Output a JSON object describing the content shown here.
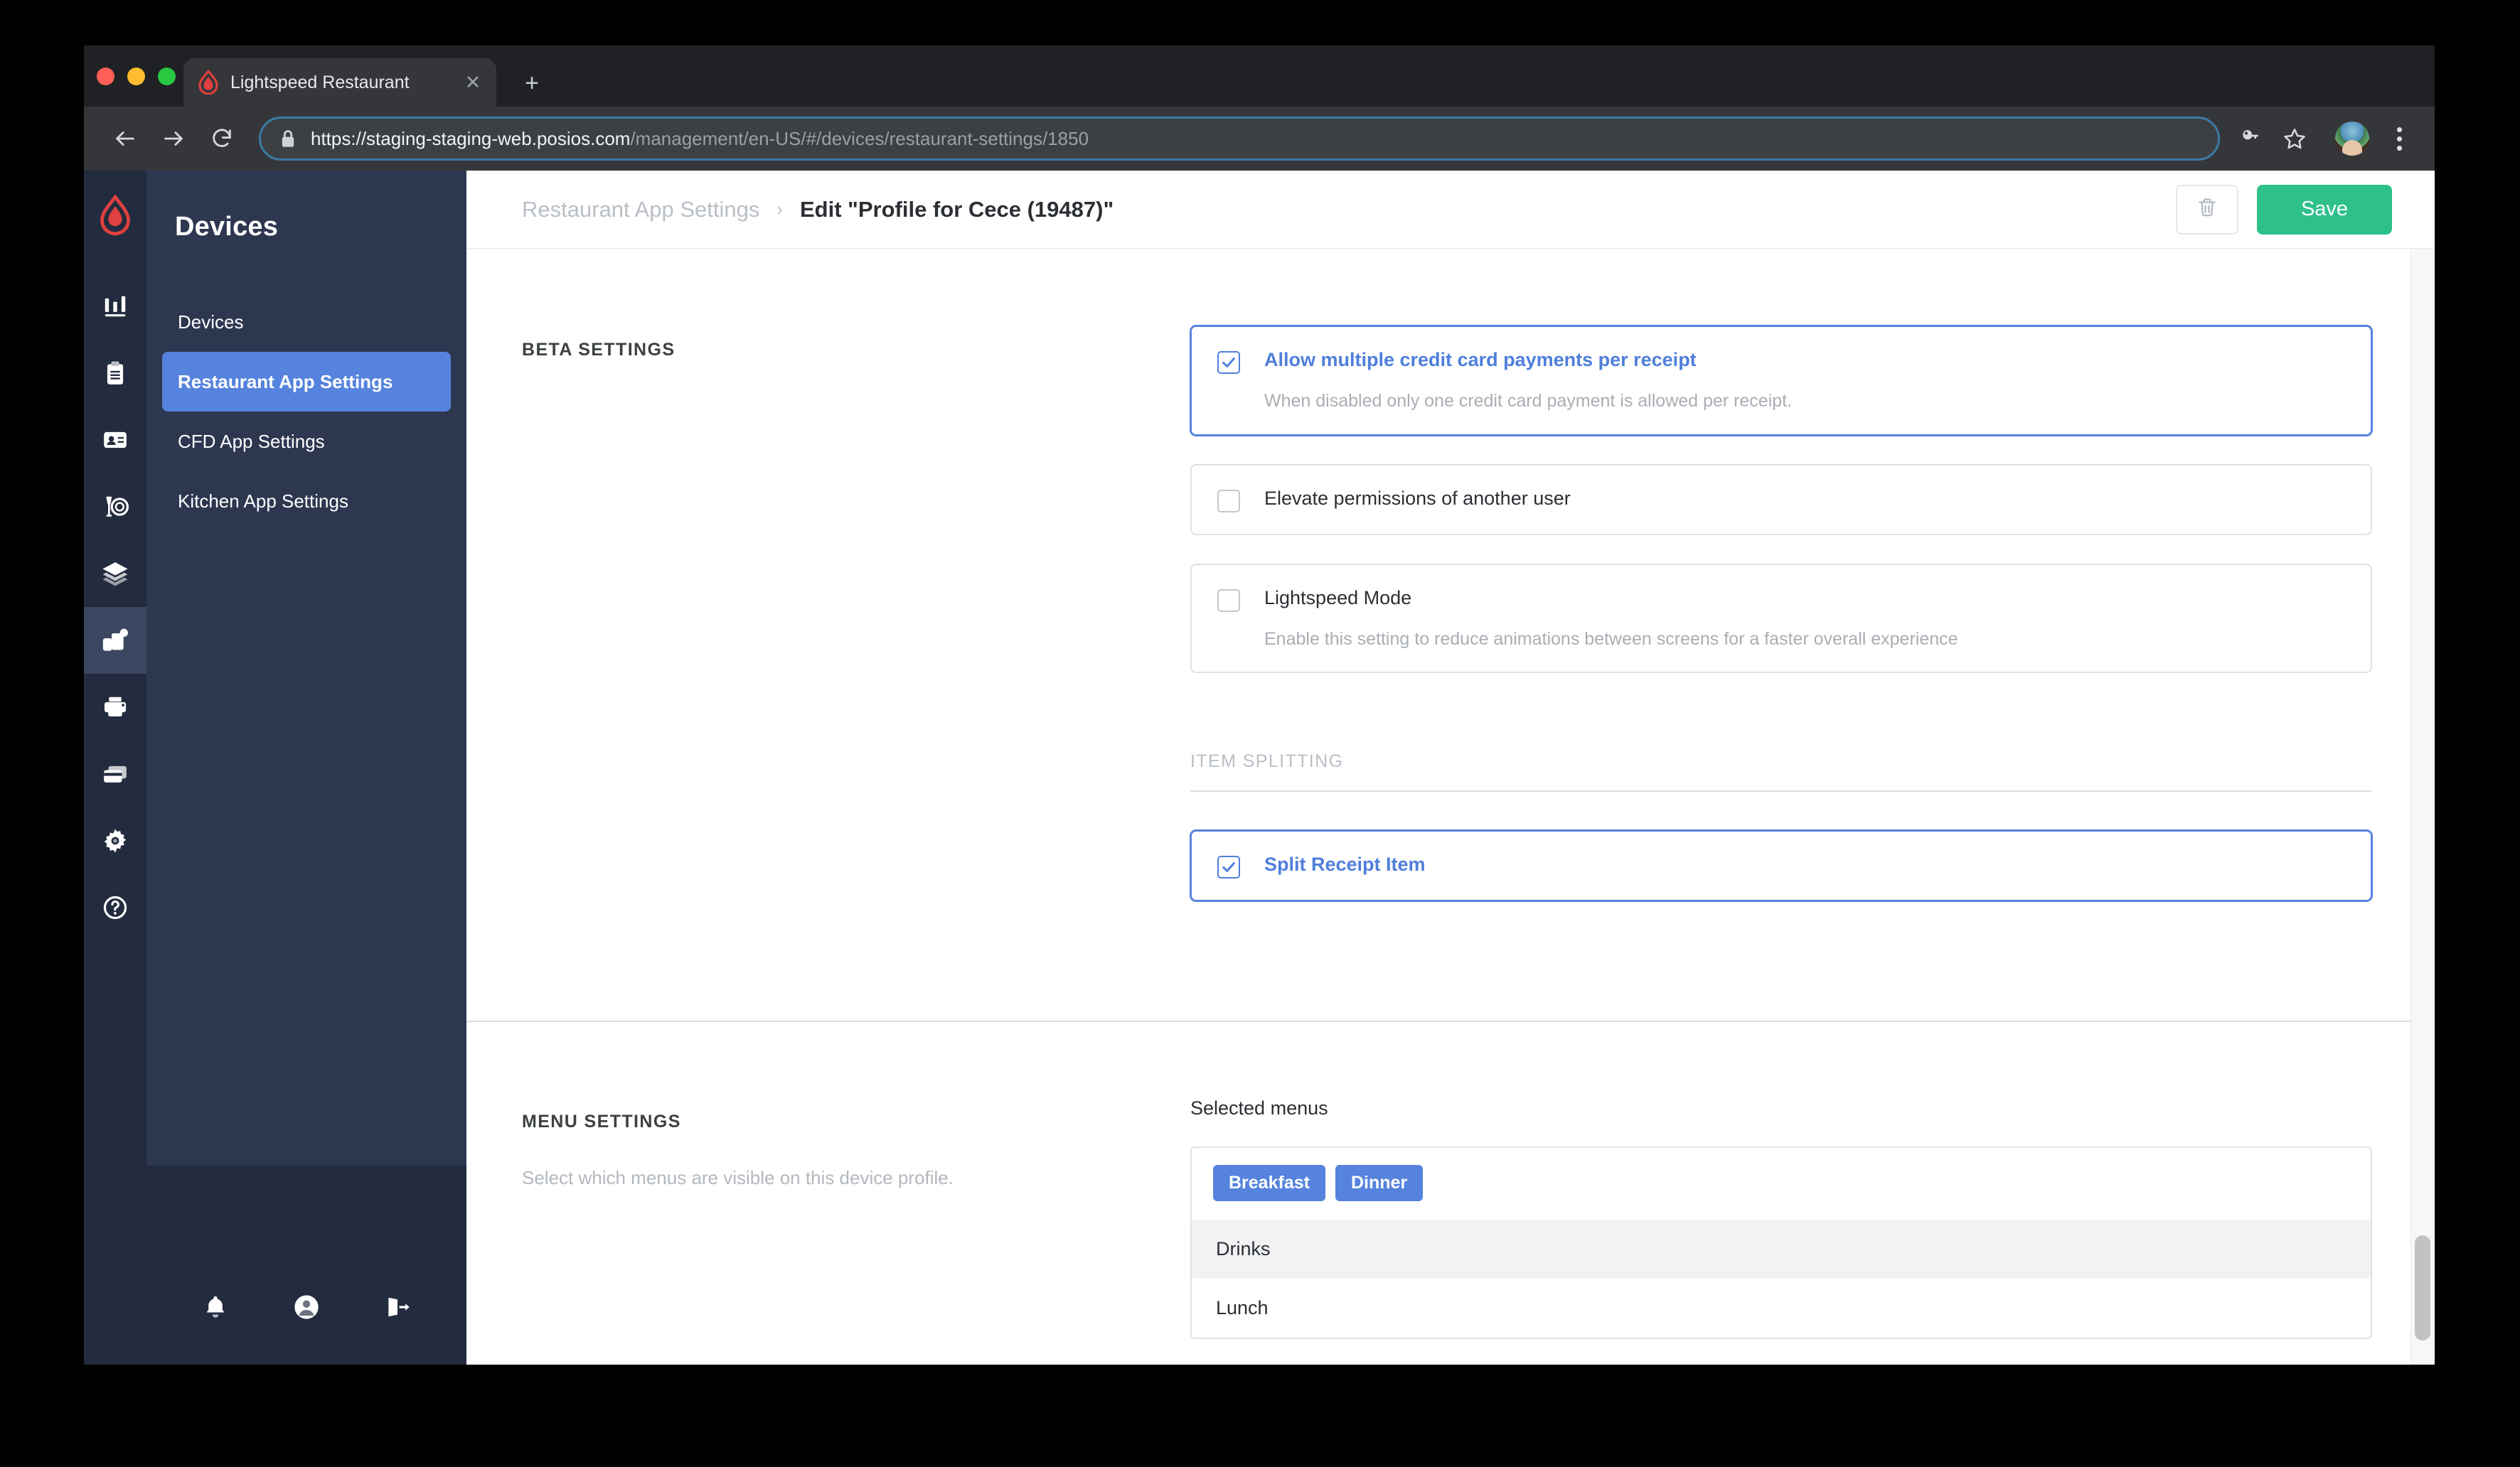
{
  "browser": {
    "tab_title": "Lightspeed Restaurant",
    "tab_close_glyph": "✕",
    "new_tab_glyph": "+",
    "url_strong": "https://staging-staging-web.posios.com",
    "url_path": "/management/en-US/#/devices/restaurant-settings/1850",
    "icons": {
      "back": "back-arrow-icon",
      "forward": "forward-arrow-icon",
      "reload": "reload-icon",
      "lock": "lock-icon",
      "password_key": "key-icon",
      "bookmark": "star-icon",
      "profile": "profile-avatar-icon",
      "menu": "kebab-menu-icon"
    }
  },
  "sidebar": {
    "title": "Devices",
    "rail_items": [
      {
        "name": "reports-icon",
        "active": false
      },
      {
        "name": "clipboard-icon",
        "active": false
      },
      {
        "name": "customer-card-icon",
        "active": false
      },
      {
        "name": "glass-plate-icon",
        "active": false
      },
      {
        "name": "layers-icon",
        "active": false
      },
      {
        "name": "devices-icon",
        "active": true
      },
      {
        "name": "printer-icon",
        "active": false
      },
      {
        "name": "payment-card-icon",
        "active": false
      },
      {
        "name": "gear-icon",
        "active": false
      },
      {
        "name": "help-circle-icon",
        "active": false
      }
    ],
    "items": [
      {
        "label": "Devices",
        "active": false
      },
      {
        "label": "Restaurant App Settings",
        "active": true
      },
      {
        "label": "CFD App Settings",
        "active": false
      },
      {
        "label": "Kitchen App Settings",
        "active": false
      }
    ],
    "store_icon": "store-icon",
    "footer_icons": [
      {
        "name": "bell-icon"
      },
      {
        "name": "user-avatar-icon"
      },
      {
        "name": "logout-icon"
      }
    ]
  },
  "header": {
    "breadcrumb_parent": "Restaurant App Settings",
    "breadcrumb_separator": "›",
    "breadcrumb_current": "Edit \"Profile for Cece (19487)\"",
    "delete_icon": "trash-icon",
    "save_label": "Save"
  },
  "beta_settings": {
    "label": "BETA SETTINGS",
    "cards": [
      {
        "label": "Allow multiple credit card payments per receipt",
        "description": "When disabled only one credit card payment is allowed per receipt.",
        "checked": true,
        "highlighted": true
      },
      {
        "label": "Elevate permissions of another user",
        "description": "",
        "checked": false,
        "highlighted": false
      },
      {
        "label": "Lightspeed Mode",
        "description": "Enable this setting to reduce animations between screens for a faster overall experience",
        "checked": false,
        "highlighted": false
      }
    ]
  },
  "item_splitting": {
    "label": "ITEM SPLITTING",
    "cards": [
      {
        "label": "Split Receipt Item",
        "description": "",
        "checked": true,
        "highlighted": true
      }
    ]
  },
  "menu_settings": {
    "label": "MENU SETTINGS",
    "description": "Select which menus are visible on this device profile.",
    "selected_menus_label": "Selected menus",
    "chips": [
      "Breakfast",
      "Dinner"
    ],
    "options": [
      {
        "label": "Drinks",
        "hovered": true
      },
      {
        "label": "Lunch",
        "hovered": false
      }
    ]
  },
  "colors": {
    "accent_blue": "#5583dd",
    "save_green": "#2ec08b",
    "sidebar_dark": "#232b3e",
    "sidebar_panel": "#2e3750",
    "brand_red": "#e0403f"
  }
}
